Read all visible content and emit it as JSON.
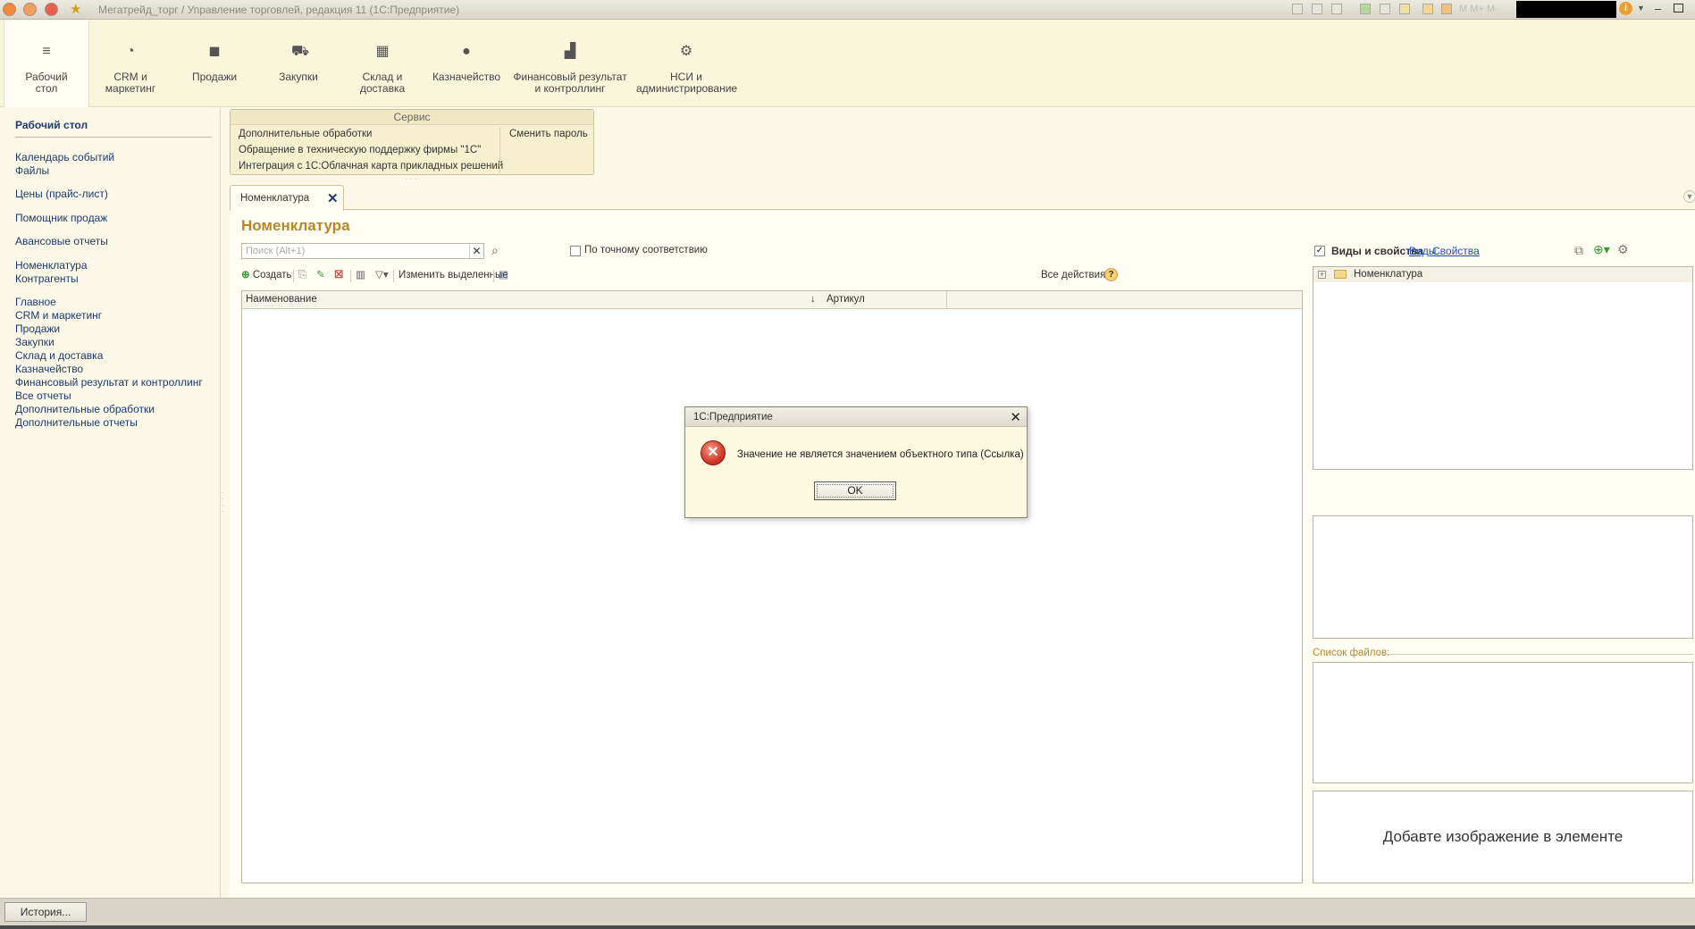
{
  "window": {
    "title": "Мегатрейд_торг / Управление торговлей, редакция 11  (1С:Предприятие)",
    "m_buttons": "M  M+  M-"
  },
  "sections": [
    {
      "label": "Рабочий стол",
      "icon": "menu-lines-icon"
    },
    {
      "label": "CRM и маркетинг",
      "icon": "pie-chart-icon"
    },
    {
      "label": "Продажи",
      "icon": "shopping-bag-icon"
    },
    {
      "label": "Закупки",
      "icon": "cart-icon"
    },
    {
      "label": "Склад и доставка",
      "icon": "grid-boxes-icon"
    },
    {
      "label": "Казначейство",
      "icon": "ruble-coin-icon"
    },
    {
      "label": "Финансовый результат и контроллинг",
      "icon": "bar-chart-icon"
    },
    {
      "label": "НСИ и администрирование",
      "icon": "gear-icon"
    }
  ],
  "nav": {
    "title": "Рабочий стол",
    "items": [
      "Календарь событий",
      "Файлы",
      "Цены (прайс-лист)",
      "Помощник продаж",
      "Авансовые отчеты",
      "Номенклатура",
      "Контрагенты",
      "Главное",
      "CRM и маркетинг",
      "Продажи",
      "Закупки",
      "Склад и доставка",
      "Казначейство",
      "Финансовый результат и контроллинг",
      "Все отчеты",
      "Дополнительные обработки",
      "Дополнительные отчеты"
    ]
  },
  "service": {
    "header": "Сервис",
    "items": [
      "Дополнительные обработки",
      "Обращение в техническую поддержку фирмы \"1С\"",
      "Интеграция с 1С:Облачная карта прикладных решений"
    ],
    "change_password": "Сменить пароль"
  },
  "tab": {
    "label": "Номенклатура",
    "close": "✕"
  },
  "form": {
    "title": "Номенклатура",
    "search_placeholder": "Поиск (Alt+1)",
    "exact_match_label": "По точному соответствию",
    "create_label": "Создать",
    "edit_selected_label": "Изменить выделенные",
    "all_actions_label": "Все действия",
    "help": "?",
    "columns": [
      "Наименование",
      "Артикул"
    ],
    "sort_indicator": "↓"
  },
  "right_panel": {
    "views_props_label": "Виды и свойства",
    "link_views": "Виды",
    "link_props": "Свойства",
    "tree_root": "Номенклатура",
    "files_label": "Список файлов:",
    "image_placeholder": "Добавте изображение в элементе"
  },
  "dialog": {
    "title": "1С:Предприятие",
    "message": "Значение не является значением объектного типа (Ссылка)",
    "ok_label": "OK",
    "icon": "error-icon"
  },
  "bottom": {
    "history_label": "История..."
  },
  "colors": {
    "background": "#fbf8e8",
    "accent_title": "#b5882a",
    "link": "#1e3a6e",
    "error": "#d23a2a"
  }
}
